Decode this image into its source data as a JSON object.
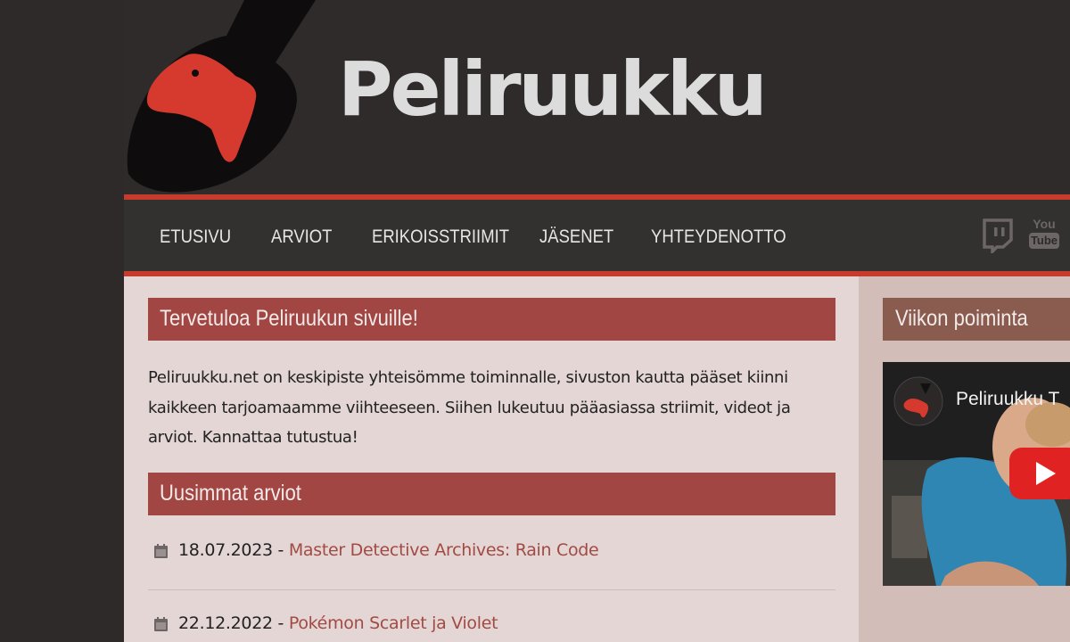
{
  "header": {
    "site_title": "Peliruukku"
  },
  "nav": {
    "items": [
      {
        "label": "ETUSIVU"
      },
      {
        "label": "ARVIOT"
      },
      {
        "label": "ERIKOISSTRIIMIT"
      },
      {
        "label": "JÄSENET"
      },
      {
        "label": "YHTEYDENOTTO"
      }
    ],
    "icons": [
      "twitch-icon",
      "youtube-icon"
    ],
    "youtube_text_top": "You",
    "youtube_text_bottom": "Tube"
  },
  "main": {
    "welcome_heading": "Tervetuloa Peliruukun sivuille!",
    "intro_text": "Peliruukku.net on keskipiste yhteisömme toiminnalle, sivuston kautta pääset kiinni kaikkeen tarjoamaamme viihteeseen. Siihen lukeutuu pääasiassa striimit, videot ja arviot. Kannattaa tutustua!",
    "reviews_heading": "Uusimmat arviot",
    "reviews": [
      {
        "date": "18.07.2023",
        "separator": " - ",
        "title": "Master Detective Archives: Rain Code"
      },
      {
        "date": "22.12.2022",
        "separator": " - ",
        "title": "Pokémon Scarlet ja Violet"
      }
    ]
  },
  "sidebar": {
    "heading": "Viikon poiminta",
    "video_title": "Peliruukku T"
  },
  "colors": {
    "accent_red": "#c63b2c",
    "section_bar": "#a14642",
    "sidebar_bar": "#8a5c4f",
    "link": "#a24a44",
    "header_bg": "#2f2b2b"
  }
}
